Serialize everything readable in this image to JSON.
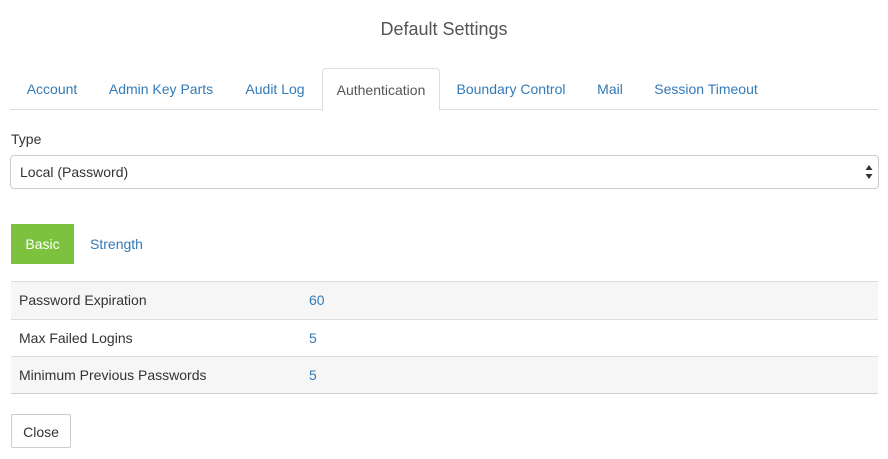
{
  "dialog": {
    "title": "Default Settings"
  },
  "tabs": [
    {
      "label": "Account",
      "active": false
    },
    {
      "label": "Admin Key Parts",
      "active": false
    },
    {
      "label": "Audit Log",
      "active": false
    },
    {
      "label": "Authentication",
      "active": true
    },
    {
      "label": "Boundary Control",
      "active": false
    },
    {
      "label": "Mail",
      "active": false
    },
    {
      "label": "Session Timeout",
      "active": false
    }
  ],
  "type_field": {
    "label": "Type",
    "selected": "Local (Password)",
    "icon": "select-arrows-icon"
  },
  "subtabs": [
    {
      "label": "Basic",
      "active": true
    },
    {
      "label": "Strength",
      "active": false
    }
  ],
  "settings": [
    {
      "label": "Password Expiration",
      "value": "60"
    },
    {
      "label": "Max Failed Logins",
      "value": "5"
    },
    {
      "label": "Minimum Previous Passwords",
      "value": "5"
    }
  ],
  "footer": {
    "close_label": "Close"
  },
  "colors": {
    "link": "#337ab7",
    "active_pill": "#7cc23e",
    "stripe": "#f6f6f6",
    "border": "#dddddd"
  }
}
